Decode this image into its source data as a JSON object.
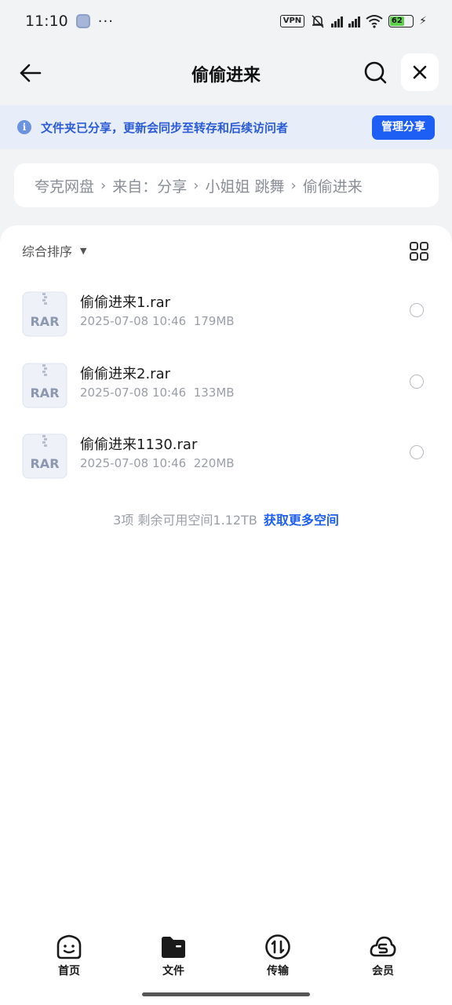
{
  "status_bar": {
    "time": "11:10",
    "dots": "···",
    "vpn": "VPN",
    "battery": "62"
  },
  "header": {
    "title": "偷偷进来"
  },
  "notice": {
    "text": "文件夹已分享，更新会同步至转存和后续访问者",
    "button": "管理分享"
  },
  "breadcrumb": [
    "夸克网盘",
    "来自：分享",
    "小姐姐 跳舞",
    "偷偷进来"
  ],
  "sort": {
    "label": "综合排序"
  },
  "files": [
    {
      "name": "偷偷进来1.rar",
      "date": "2025-07-08 10:46",
      "size": "179MB",
      "type": "RAR"
    },
    {
      "name": "偷偷进来2.rar",
      "date": "2025-07-08 10:46",
      "size": "133MB",
      "type": "RAR"
    },
    {
      "name": "偷偷进来1130.rar",
      "date": "2025-07-08 10:46",
      "size": "220MB",
      "type": "RAR"
    }
  ],
  "footer": {
    "summary": "3项 剩余可用空间1.12TB",
    "link": "获取更多空间"
  },
  "tabs": [
    {
      "label": "首页",
      "icon": "home-face-icon"
    },
    {
      "label": "文件",
      "icon": "folder-icon"
    },
    {
      "label": "传输",
      "icon": "transfer-icon"
    },
    {
      "label": "会员",
      "icon": "vip-cloud-icon"
    }
  ],
  "colors": {
    "accent": "#1d5ef5",
    "notice_bg": "#e8eef9",
    "page_bg": "#f2f3f5"
  }
}
